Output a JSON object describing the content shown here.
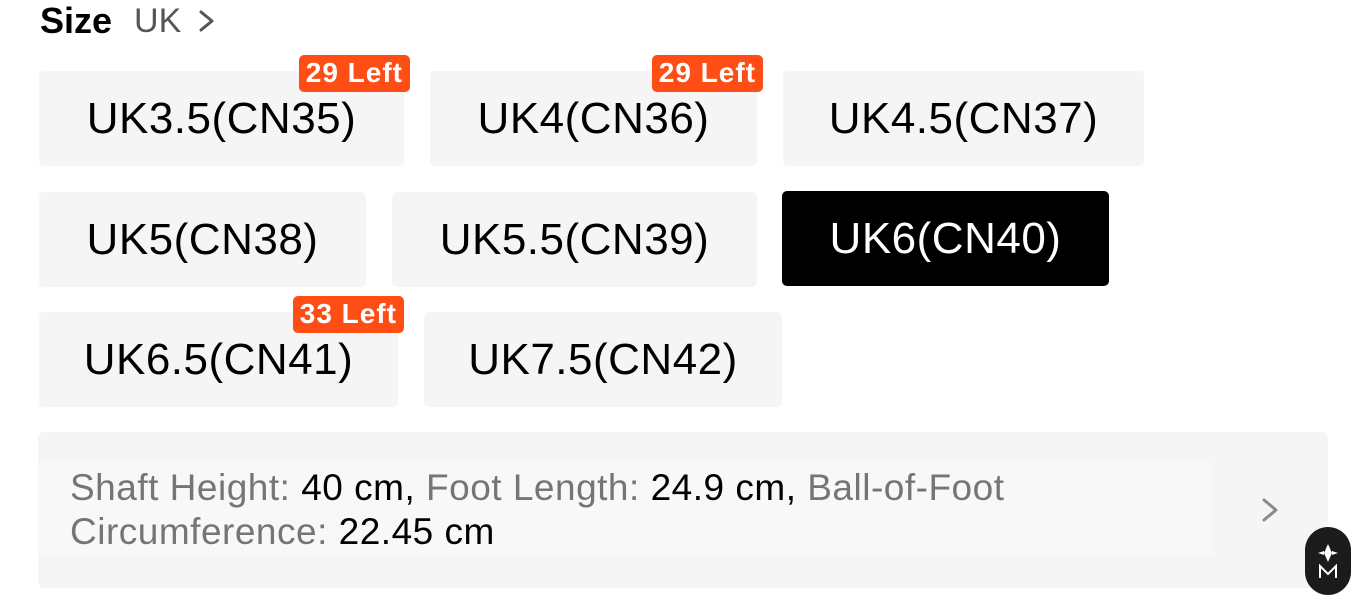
{
  "size_header": {
    "title": "Size",
    "system": "UK"
  },
  "sizes": [
    {
      "label": "UK3.5(CN35)",
      "badge": "29 Left",
      "selected": false
    },
    {
      "label": "UK4(CN36)",
      "badge": "29 Left",
      "selected": false
    },
    {
      "label": "UK4.5(CN37)",
      "badge": null,
      "selected": false
    },
    {
      "label": "UK5(CN38)",
      "badge": null,
      "selected": false
    },
    {
      "label": "UK5.5(CN39)",
      "badge": null,
      "selected": false
    },
    {
      "label": "UK6(CN40)",
      "badge": null,
      "selected": true
    },
    {
      "label": "UK6.5(CN41)",
      "badge": "33 Left",
      "selected": false
    },
    {
      "label": "UK7.5(CN42)",
      "badge": null,
      "selected": false
    }
  ],
  "measurements": {
    "shaft_height_label": "Shaft Height:",
    "shaft_height_value": "40 cm",
    "foot_length_label": "Foot Length:",
    "foot_length_value": "24.9 cm",
    "ball_label_line1": "Ball-of-Foot",
    "ball_label_line2": "Circumference:",
    "ball_value": "22.45 cm"
  },
  "colors": {
    "badge": "#ff4d16",
    "chip_bg": "#f5f5f5",
    "selected_bg": "#000000"
  },
  "icons": {
    "size_system_chevron": "chevron-right-icon",
    "measurements_chevron": "chevron-right-icon",
    "assistant": "assistant-logo-icon"
  }
}
